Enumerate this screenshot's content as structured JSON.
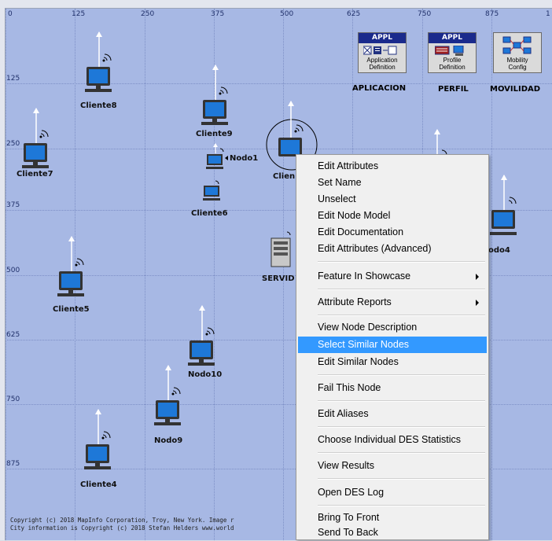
{
  "axis": {
    "x_ticks": [
      "0",
      "125",
      "250",
      "375",
      "500",
      "625",
      "750",
      "875",
      "1"
    ],
    "y_ticks": [
      "125",
      "250",
      "375",
      "500",
      "625",
      "750",
      "875"
    ]
  },
  "nodes": {
    "cliente8": "Cliente8",
    "cliente9": "Cliente9",
    "nodo1": "Nodo1",
    "cliente7": "Cliente7",
    "cliente6": "Cliente6",
    "clien": "Clien",
    "servid": "SERVID",
    "nodo4": "odo4",
    "cliente5": "Cliente5",
    "nodo10": "Nodo10",
    "nodo9": "Nodo9",
    "cliente4": "Cliente4"
  },
  "config_objects": [
    {
      "header": "APPL",
      "line1": "Application",
      "line2": "Definition",
      "name": "APLICACION",
      "icon": "application-definition-icon"
    },
    {
      "header": "APPL",
      "line1": "Profile",
      "line2": "Definition",
      "name": "PERFIL",
      "icon": "profile-definition-icon"
    },
    {
      "header": "",
      "line1": "Mobility",
      "line2": "Config",
      "name": "MOVILIDAD",
      "icon": "mobility-config-icon"
    }
  ],
  "copyright": {
    "line1": "Copyright (c) 2018 MapInfo Corporation, Troy, New York. Image r",
    "line2": "City information is Copyright (c) 2018 Stefan Helders www.world"
  },
  "context_menu": {
    "items": [
      {
        "label": "Edit Attributes"
      },
      {
        "label": "Set Name"
      },
      {
        "label": "Unselect"
      },
      {
        "label": "Edit Node Model"
      },
      {
        "label": "Edit Documentation"
      },
      {
        "label": "Edit Attributes (Advanced)"
      },
      {
        "label": "Feature In Showcase",
        "submenu": true
      },
      {
        "label": "Attribute Reports",
        "submenu": true
      },
      {
        "label": "View Node Description"
      },
      {
        "label": "Select Similar Nodes",
        "highlighted": true
      },
      {
        "label": "Edit Similar Nodes"
      },
      {
        "label": "Fail This Node"
      },
      {
        "label": "Edit Aliases"
      },
      {
        "label": "Choose Individual DES Statistics"
      },
      {
        "label": "View Results"
      },
      {
        "label": "Open DES Log"
      },
      {
        "label": "Bring To Front"
      },
      {
        "label": "Send To Back"
      }
    ]
  },
  "colors": {
    "canvas": "#a7b8e4",
    "highlight": "#3399ff",
    "screen": "#1e78d8"
  }
}
